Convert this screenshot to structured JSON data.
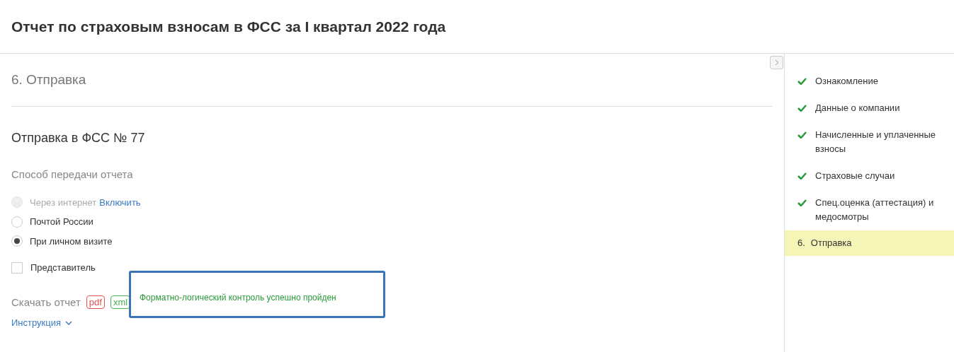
{
  "page_title": "Отчет по страховым взносам в ФСС за I квартал 2022 года",
  "section_title": "6. Отправка",
  "subtitle": "Отправка в ФСС № 77",
  "method_label": "Способ передачи отчета",
  "methods": [
    {
      "label": "Через интернет",
      "link": "Включить",
      "disabled": true,
      "selected": false
    },
    {
      "label": "Почтой России",
      "disabled": false,
      "selected": false
    },
    {
      "label": "При личном визите",
      "disabled": false,
      "selected": true
    }
  ],
  "representative": {
    "label": "Представитель",
    "checked": false
  },
  "download": {
    "label": "Скачать отчет",
    "formats": [
      {
        "label": "pdf",
        "color": "#e05050"
      },
      {
        "label": "xml",
        "color": "#4caf50"
      }
    ]
  },
  "instruction": "Инструкция",
  "popup": "Форматно-логический контроль успешно пройден",
  "steps": [
    {
      "kind": "done",
      "label": "Ознакомление",
      "selected": false
    },
    {
      "kind": "done",
      "label": "Данные о компании",
      "selected": false
    },
    {
      "kind": "done",
      "label": "Начисленные и уплаченные взносы",
      "selected": false
    },
    {
      "kind": "done",
      "label": "Страховые случаи",
      "selected": false
    },
    {
      "kind": "done",
      "label": "Спец.оценка (аттестация) и медосмотры",
      "selected": false
    },
    {
      "kind": "numbered",
      "number": "6.",
      "label": "Отправка",
      "selected": true
    }
  ]
}
